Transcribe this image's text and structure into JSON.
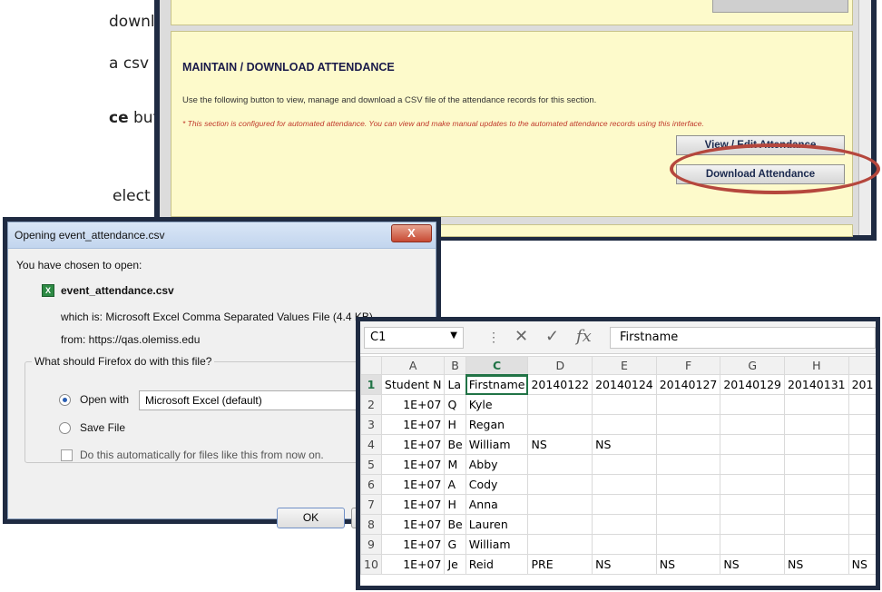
{
  "doc": {
    "line1": "download",
    "line2": "a csv file.",
    "line3_bold": "ce",
    "line3_rest": " button.",
    "line4": "elect Ok."
  },
  "web": {
    "section_title": "MAINTAIN / DOWNLOAD ATTENDANCE",
    "description": "Use the following button to view, manage and download a CSV file of the attendance records for this section.",
    "note": "* This section is configured for automated attendance. You can view and make manual updates to the automated attendance records using this interface.",
    "view_button": "View / Edit Attendance",
    "download_button": "Download Attendance",
    "highlight_color": "#b5473d",
    "panel_color": "#fdfacb"
  },
  "dialog": {
    "title": "Opening event_attendance.csv",
    "close_label": "X",
    "chosen_label": "You have chosen to open:",
    "file_icon": "excel-file-icon",
    "file_name": "event_attendance.csv",
    "which_is": "which is: Microsoft Excel Comma Separated Values File (4.4 KB)",
    "from": "from: https://qas.olemiss.edu",
    "question": "What should Firefox do with this file?",
    "open_with_label": "Open with",
    "open_with_app": "Microsoft Excel (default)",
    "save_file_label": "Save File",
    "auto_label": "Do this automatically for files like this from now on.",
    "ok_label": "OK"
  },
  "excel": {
    "name_box": "C1",
    "formula": "Firstname",
    "columns": [
      "A",
      "B",
      "C",
      "D",
      "E",
      "F",
      "G",
      "H",
      ""
    ],
    "rows": [
      {
        "n": "1",
        "cells": [
          "Student N",
          "La",
          "Firstname",
          "20140122",
          "20140124",
          "20140127",
          "20140129",
          "20140131",
          "201"
        ]
      },
      {
        "n": "2",
        "cells": [
          "1E+07",
          "Q",
          "Kyle",
          "",
          "",
          "",
          "",
          "",
          ""
        ]
      },
      {
        "n": "3",
        "cells": [
          "1E+07",
          "H",
          "Regan",
          "",
          "",
          "",
          "",
          "",
          ""
        ]
      },
      {
        "n": "4",
        "cells": [
          "1E+07",
          "Be",
          "William",
          "NS",
          "NS",
          "",
          "",
          "",
          ""
        ]
      },
      {
        "n": "5",
        "cells": [
          "1E+07",
          "M",
          "Abby",
          "",
          "",
          "",
          "",
          "",
          ""
        ]
      },
      {
        "n": "6",
        "cells": [
          "1E+07",
          "A",
          "Cody",
          "",
          "",
          "",
          "",
          "",
          ""
        ]
      },
      {
        "n": "7",
        "cells": [
          "1E+07",
          "H",
          "Anna",
          "",
          "",
          "",
          "",
          "",
          ""
        ]
      },
      {
        "n": "8",
        "cells": [
          "1E+07",
          "Be",
          "Lauren",
          "",
          "",
          "",
          "",
          "",
          ""
        ]
      },
      {
        "n": "9",
        "cells": [
          "1E+07",
          "G",
          "William",
          "",
          "",
          "",
          "",
          "",
          ""
        ]
      },
      {
        "n": "10",
        "cells": [
          "1E+07",
          "Je",
          "Reid",
          "PRE",
          "NS",
          "NS",
          "NS",
          "NS",
          "NS"
        ]
      }
    ]
  }
}
